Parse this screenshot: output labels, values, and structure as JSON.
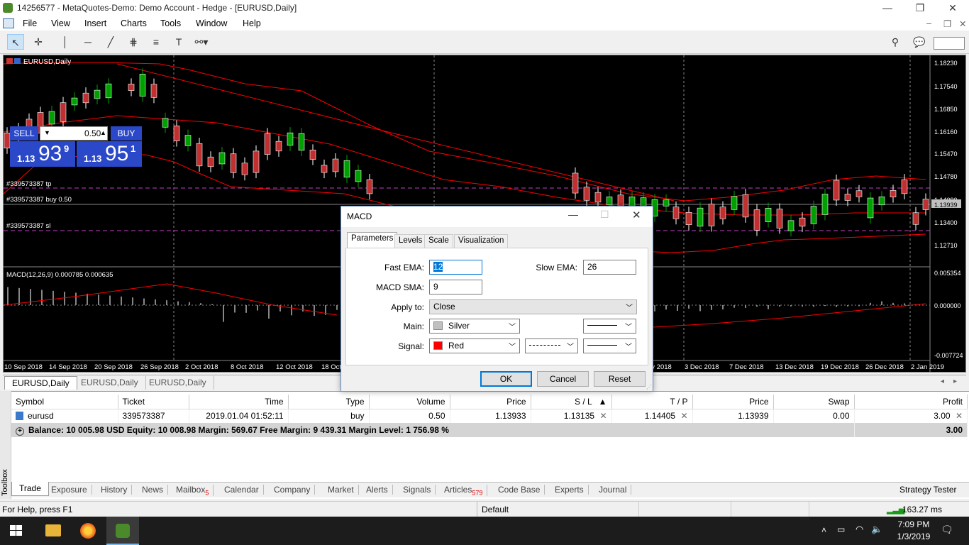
{
  "window": {
    "title": "14256577 - MetaQuotes-Demo: Demo Account - Hedge - [EURUSD,Daily]"
  },
  "menu": [
    "File",
    "View",
    "Insert",
    "Charts",
    "Tools",
    "Window",
    "Help"
  ],
  "chart": {
    "symbol_label": "EURUSD,Daily",
    "sell_label": "SELL",
    "buy_label": "BUY",
    "lot": "0.50",
    "sell_price": {
      "prefix": "1.13",
      "big": "93",
      "sup": "9"
    },
    "buy_price": {
      "prefix": "1.13",
      "big": "95",
      "sup": "1"
    },
    "lines": {
      "tp": "#339573387 tp",
      "buy": "#339573387 buy 0.50",
      "sl": "#339573387 sl"
    },
    "price_axis": [
      "1.18230",
      "1.17540",
      "1.16850",
      "1.16160",
      "1.15470",
      "1.14780",
      "1.14090",
      "1.13939",
      "1.13400",
      "1.12710"
    ],
    "macd_label": "MACD(12,26,9) 0.000785 0.000635",
    "macd_axis": [
      "0.005354",
      "0.000000",
      "-0.007724"
    ],
    "date_axis": [
      "10 Sep 2018",
      "14 Sep 2018",
      "20 Sep 2018",
      "26 Sep 2018",
      "2 Oct 2018",
      "8 Oct 2018",
      "12 Oct 2018",
      "18 Oct",
      "ov 2018",
      "3 Dec 2018",
      "7 Dec 2018",
      "13 Dec 2018",
      "19 Dec 2018",
      "26 Dec 2018",
      "2 Jan 2019"
    ],
    "colors": {
      "bull": "#00a000",
      "bear": "#c03030",
      "bands": "#ff0000",
      "bg": "#000000"
    }
  },
  "chart_tabs": [
    "EURUSD,Daily",
    "EURUSD,Daily",
    "EURUSD,Daily"
  ],
  "dialog": {
    "title": "MACD",
    "tabs": [
      "Parameters",
      "Levels",
      "Scale",
      "Visualization"
    ],
    "fast_ema_label": "Fast EMA:",
    "fast_ema": "12",
    "slow_ema_label": "Slow EMA:",
    "slow_ema": "26",
    "macd_sma_label": "MACD SMA:",
    "macd_sma": "9",
    "apply_label": "Apply to:",
    "apply": "Close",
    "main_label": "Main:",
    "main_color": "Silver",
    "signal_label": "Signal:",
    "signal_color": "Red",
    "ok": "OK",
    "cancel": "Cancel",
    "reset": "Reset"
  },
  "trade": {
    "headers": [
      "Symbol",
      "Ticket",
      "Time",
      "Type",
      "Volume",
      "Price",
      "S / L",
      "T / P",
      "Price",
      "Swap",
      "Profit"
    ],
    "row": [
      "eurusd",
      "339573387",
      "2019.01.04 01:52:11",
      "buy",
      "0.50",
      "1.13933",
      "1.13135",
      "1.14405",
      "1.13939",
      "0.00",
      "3.00"
    ],
    "balance": "Balance: 10 005.98 USD  Equity: 10 008.98  Margin: 569.67  Free Margin: 9 439.31  Margin Level: 1 756.98 %",
    "balance_profit": "3.00"
  },
  "toolbox_label": "Toolbox",
  "bottom_tabs": [
    {
      "label": "Trade",
      "badge": ""
    },
    {
      "label": "Exposure",
      "badge": ""
    },
    {
      "label": "History",
      "badge": ""
    },
    {
      "label": "News",
      "badge": ""
    },
    {
      "label": "Mailbox",
      "badge": "5"
    },
    {
      "label": "Calendar",
      "badge": ""
    },
    {
      "label": "Company",
      "badge": ""
    },
    {
      "label": "Market",
      "badge": ""
    },
    {
      "label": "Alerts",
      "badge": ""
    },
    {
      "label": "Signals",
      "badge": ""
    },
    {
      "label": "Articles",
      "badge": "579"
    },
    {
      "label": "Code Base",
      "badge": ""
    },
    {
      "label": "Experts",
      "badge": ""
    },
    {
      "label": "Journal",
      "badge": ""
    }
  ],
  "strategy_tester": "Strategy Tester",
  "status": {
    "help": "For Help, press F1",
    "profile": "Default",
    "ping": "163.27 ms"
  },
  "taskbar": {
    "time": "7:09 PM",
    "date": "1/3/2019"
  }
}
